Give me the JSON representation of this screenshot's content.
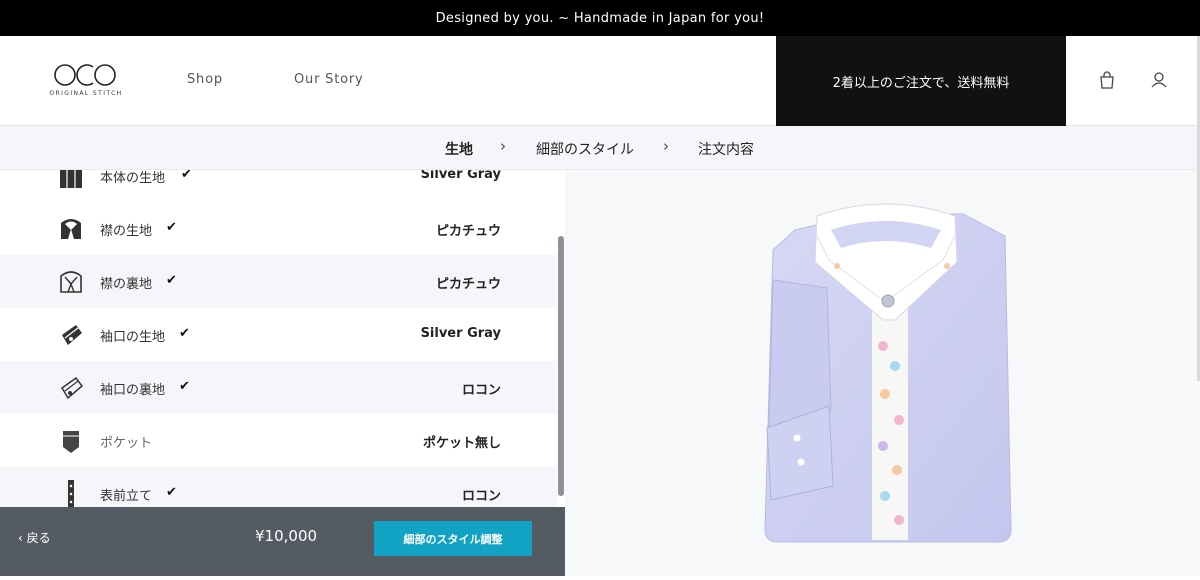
{
  "announcement": "Designed by you. ~ Handmade in Japan for you!",
  "header": {
    "logo_text": "ORIGINAL STITCH",
    "nav": [
      "Shop",
      "Our Story"
    ],
    "promo": "2着以上のご注文で、送料無料",
    "icons": [
      "bag-icon",
      "user-icon"
    ]
  },
  "steps": [
    {
      "label": "生地",
      "active": true
    },
    {
      "label": "細部のスタイル",
      "active": false
    },
    {
      "label": "注文内容",
      "active": false
    }
  ],
  "options": [
    {
      "icon": "body-fabric-icon",
      "label": "本体の生地",
      "checked": true,
      "value": "Silver Gray"
    },
    {
      "icon": "collar-fabric-icon",
      "label": "襟の生地",
      "checked": true,
      "value": "ピカチュウ"
    },
    {
      "icon": "collar-lining-icon",
      "label": "襟の裏地",
      "checked": true,
      "value": "ピカチュウ"
    },
    {
      "icon": "cuff-fabric-icon",
      "label": "袖口の生地",
      "checked": true,
      "value": "Silver Gray"
    },
    {
      "icon": "cuff-lining-icon",
      "label": "袖口の裏地",
      "checked": true,
      "value": "ロコン"
    },
    {
      "icon": "pocket-icon",
      "label": "ポケット",
      "checked": false,
      "value": "ポケット無し"
    },
    {
      "icon": "placket-icon",
      "label": "表前立て",
      "checked": true,
      "value": "ロコン"
    }
  ],
  "check_mark": "✔",
  "footer": {
    "back_label": "‹ 戻る",
    "price": "¥10,000",
    "cta_label": "細部のスタイル調整"
  },
  "colors": {
    "accent": "#12a3c4",
    "footer_bg": "#555b63",
    "shirt": "#cfd0f2",
    "collar": "#ffffff"
  }
}
